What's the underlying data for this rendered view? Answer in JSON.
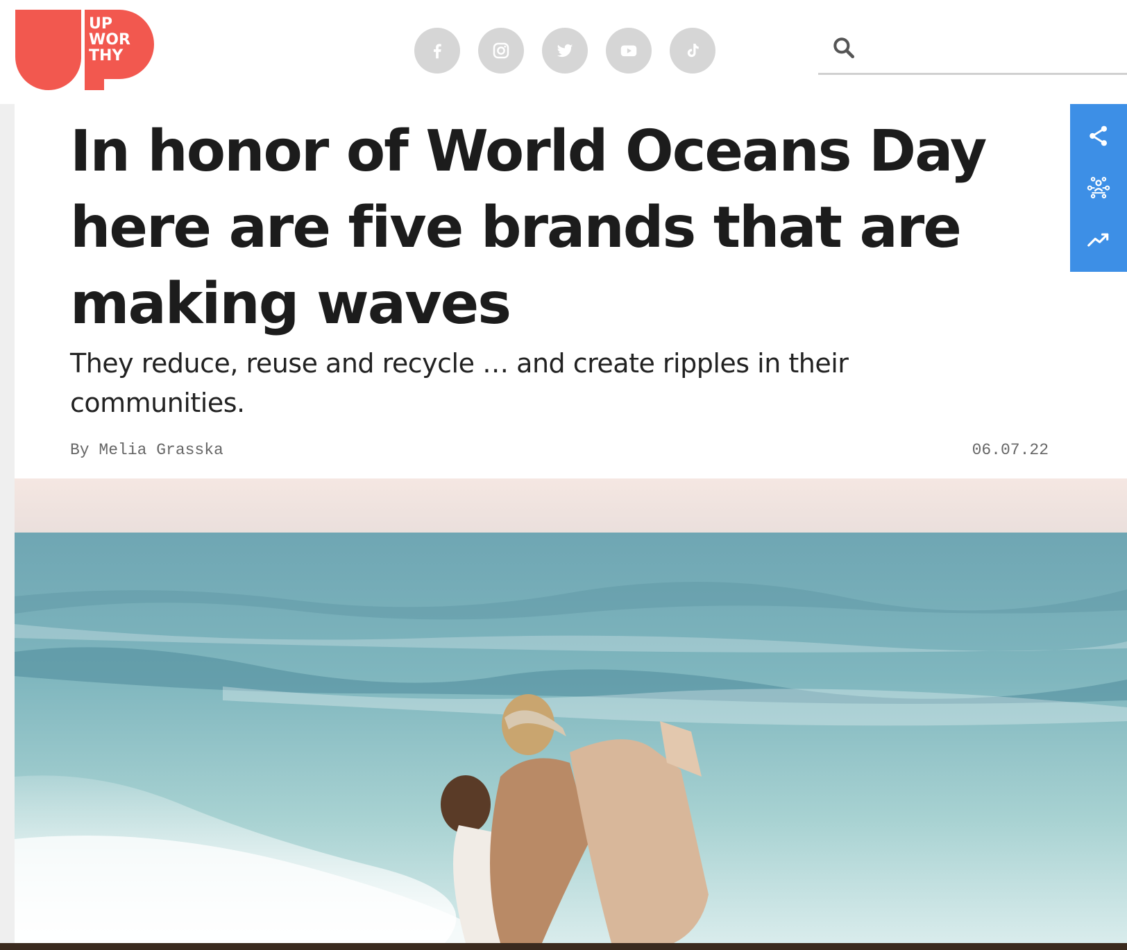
{
  "brand": {
    "logo_lines": [
      "UP",
      "WOR",
      "THY"
    ],
    "logo_color": "#f2584f"
  },
  "social": [
    {
      "name": "facebook-icon",
      "label": "Facebook"
    },
    {
      "name": "instagram-icon",
      "label": "Instagram"
    },
    {
      "name": "twitter-icon",
      "label": "Twitter"
    },
    {
      "name": "youtube-icon",
      "label": "YouTube"
    },
    {
      "name": "tiktok-icon",
      "label": "TikTok"
    }
  ],
  "search": {
    "value": "",
    "icon": "search-icon"
  },
  "article": {
    "headline": "In honor of World Oceans Day here are five brands that are making waves",
    "subtitle": "They reduce, reuse and recycle … and create ripples in their communities.",
    "byline": "By Melia Grasska",
    "date": "06.07.22"
  },
  "share_bar": {
    "items": [
      {
        "name": "share-icon"
      },
      {
        "name": "community-icon"
      },
      {
        "name": "trending-icon"
      }
    ],
    "color": "#3d8fe6"
  },
  "colors": {
    "social_circle": "#d6d6d6",
    "text": "#1c1c1c",
    "meta_text": "#666666"
  }
}
